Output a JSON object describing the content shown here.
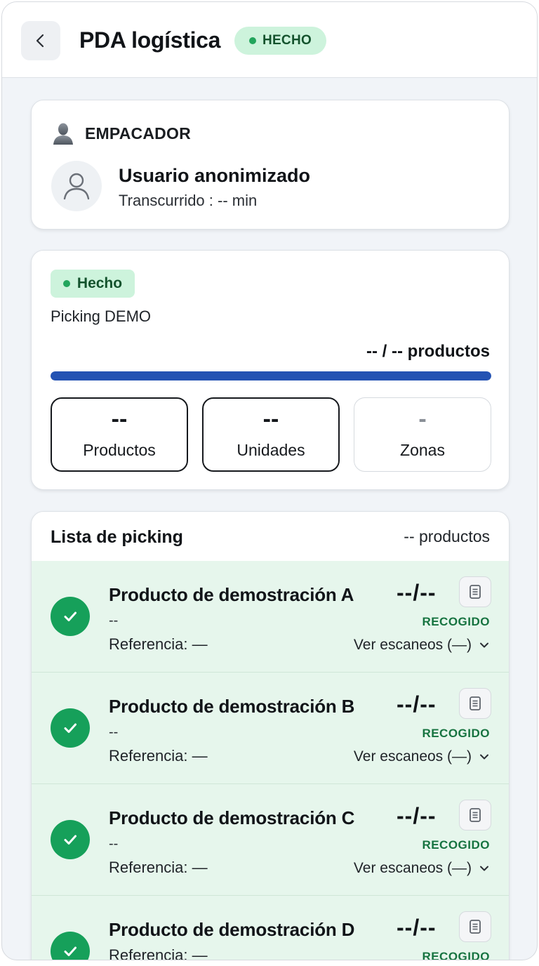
{
  "header": {
    "title": "PDA logística",
    "status": "HECHO",
    "back_icon": "chevron-left-icon"
  },
  "packer": {
    "heading": "EMPACADOR",
    "user_name": "Usuario anonimizado",
    "elapsed": "Transcurrido : -- min"
  },
  "summary": {
    "status_tag": "Hecho",
    "picking_name": "Picking DEMO",
    "progress_text": "-- / -- productos",
    "progress_fraction": 1.0,
    "stats": [
      {
        "value": "--",
        "label": "Productos"
      },
      {
        "value": "--",
        "label": "Unidades"
      },
      {
        "value": "-",
        "label": "Zonas"
      }
    ]
  },
  "picking_list": {
    "title": "Lista de picking",
    "count": "-- productos",
    "items": [
      {
        "name": "Producto de demostración A",
        "sub": "--",
        "reference": "Referencia: —",
        "qty": "--/--",
        "state": "RECOGIDO",
        "scans": "Ver escaneos (—)"
      },
      {
        "name": "Producto de demostración B",
        "sub": "--",
        "reference": "Referencia: —",
        "qty": "--/--",
        "state": "RECOGIDO",
        "scans": "Ver escaneos (—)"
      },
      {
        "name": "Producto de demostración C",
        "sub": "--",
        "reference": "Referencia: —",
        "qty": "--/--",
        "state": "RECOGIDO",
        "scans": "Ver escaneos (—)"
      },
      {
        "name": "Producto de demostración D",
        "reference": "Referencia: —",
        "qty": "--/--",
        "state": "RECOGIDO"
      }
    ]
  },
  "colors": {
    "accent_green": "#16a05a",
    "pill_green_bg": "#cdf3dc",
    "progress_blue": "#2453b3",
    "row_bg": "#e6f6ec"
  }
}
